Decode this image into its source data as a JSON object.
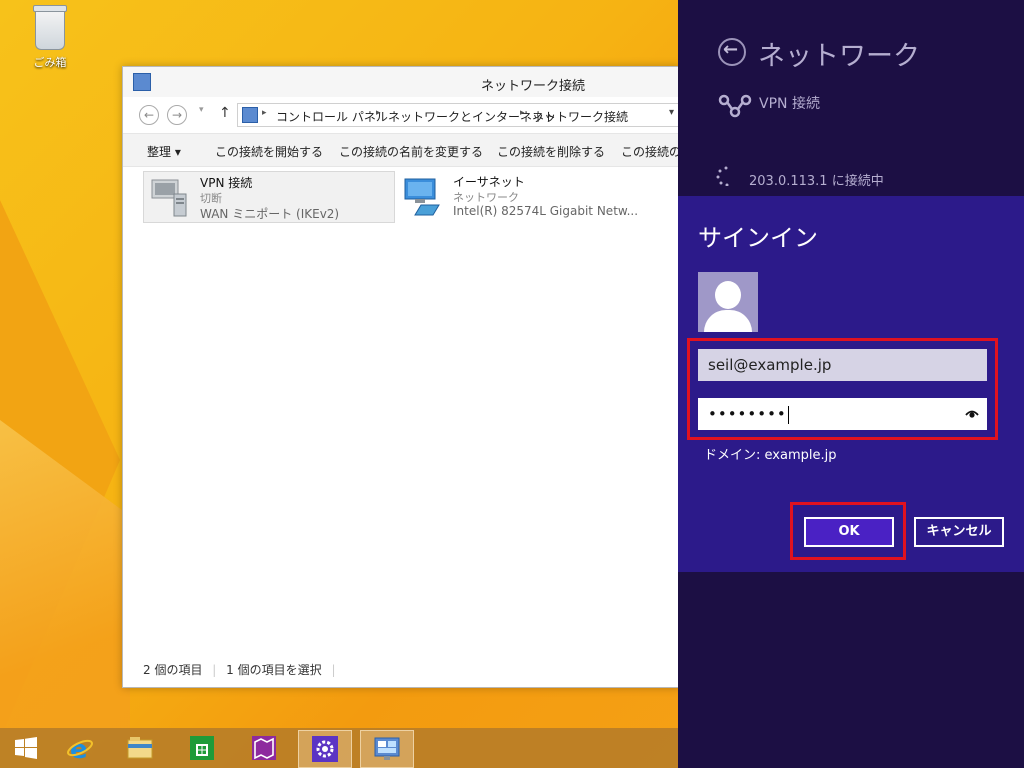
{
  "desktop": {
    "recycle_bin_label": "ごみ箱"
  },
  "explorer": {
    "title": "ネットワーク接続",
    "breadcrumb": [
      "コントロール パネル",
      "ネットワークとインターネット",
      "ネットワーク接続"
    ],
    "commands": [
      "整理 ▾",
      "この接続を開始する",
      "この接続の名前を変更する",
      "この接続を削除する",
      "この接続の設"
    ],
    "items": [
      {
        "name": "VPN 接続",
        "status": "切断",
        "device": "WAN ミニポート (IKEv2)",
        "selected": true
      },
      {
        "name": "イーサネット",
        "status": "ネットワーク",
        "device": "Intel(R) 82574L Gigabit Netw..."
      }
    ],
    "status": {
      "count": "2 個の項目",
      "selected": "1 個の項目を選択"
    }
  },
  "taskbar": {
    "icons": [
      "windows-start-icon",
      "internet-explorer-icon",
      "file-explorer-icon",
      "store-icon",
      "maps-icon",
      "settings-icon",
      "network-connections-icon"
    ]
  },
  "charm": {
    "title": "ネットワーク",
    "vpn_name": "VPN 接続",
    "connecting_text": "203.0.113.1 に接続中",
    "signin": {
      "title": "サインイン",
      "username": "seil@example.jp",
      "password_mask": "••••••••",
      "domain": "ドメイン: example.jp",
      "ok_label": "OK",
      "cancel_label": "キャンセル"
    },
    "colors": {
      "panel": "#1c0f44",
      "signin": "#2c1a8a",
      "highlight": "#e0121f",
      "ok": "#4a21c4"
    }
  }
}
